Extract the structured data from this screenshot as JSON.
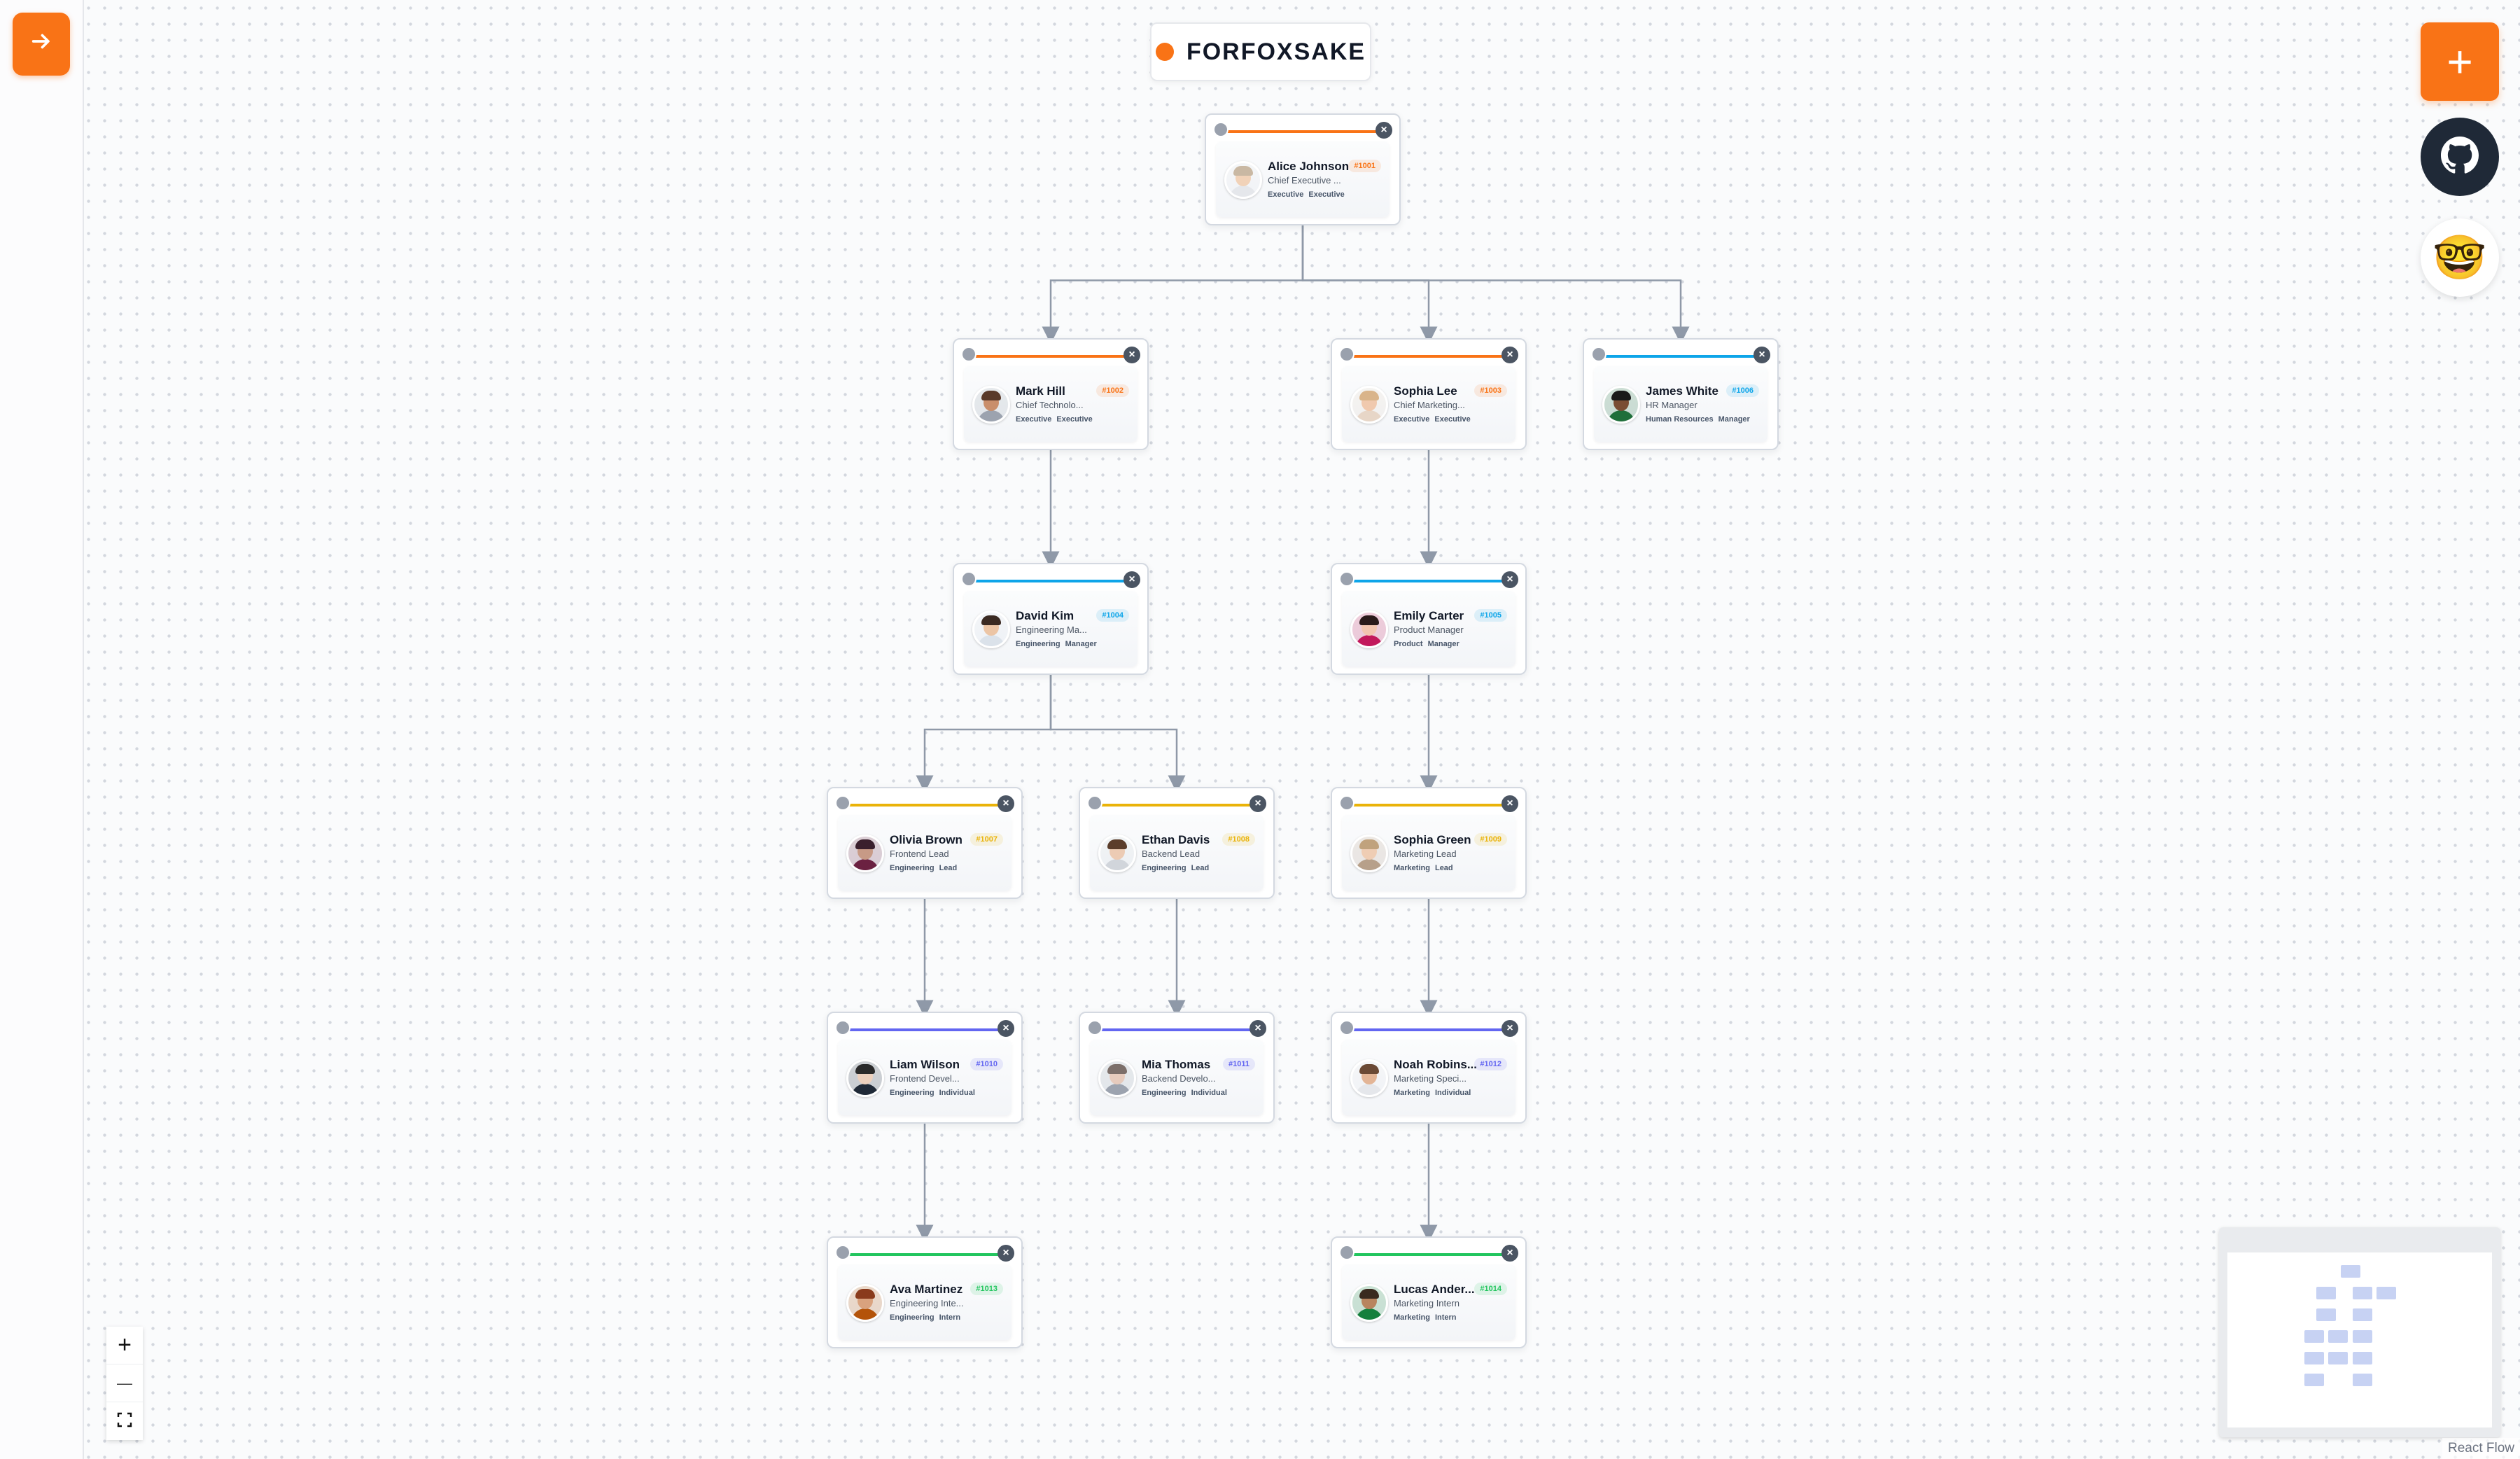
{
  "brand": {
    "name": "FORFOXSAKE",
    "dot_color": "#f97316"
  },
  "sidebar": {
    "toggle_icon": "arrow-right-icon"
  },
  "toolbar": {
    "add_icon": "+",
    "github_icon": "github-icon",
    "emoji": "🤓"
  },
  "zoom_controls": {
    "zoom_in": "+",
    "zoom_out": "—",
    "fit": "fit-view-icon"
  },
  "attribution": "React Flow",
  "nodes": [
    {
      "id": "1001",
      "name": "Alice Johnson",
      "title": "Chief Executive ...",
      "department": "Executive",
      "level": "Executive",
      "badge": "#1001",
      "color": "#f97316",
      "avatar": {
        "skin": "#f1d2b8",
        "hair": "#c9b8a3",
        "shirt": "#e5e7eb"
      }
    },
    {
      "id": "1002",
      "name": "Mark Hill",
      "title": "Chief Technolo...",
      "department": "Executive",
      "level": "Executive",
      "badge": "#1002",
      "color": "#f97316",
      "avatar": {
        "skin": "#c98e6b",
        "hair": "#5a3a2a",
        "shirt": "#9ca3af"
      }
    },
    {
      "id": "1003",
      "name": "Sophia Lee",
      "title": "Chief Marketing...",
      "department": "Executive",
      "level": "Executive",
      "badge": "#1003",
      "color": "#f97316",
      "avatar": {
        "skin": "#f0c9ae",
        "hair": "#d9b48a",
        "shirt": "#e7d6c7"
      }
    },
    {
      "id": "1006",
      "name": "James White",
      "title": "HR Manager",
      "department": "Human Resources",
      "level": "Manager",
      "badge": "#1006",
      "color": "#0ea5e9",
      "avatar": {
        "skin": "#7a4d33",
        "hair": "#1a1a1a",
        "shirt": "#1f6f3a"
      }
    },
    {
      "id": "1004",
      "name": "David Kim",
      "title": "Engineering Ma...",
      "department": "Engineering",
      "level": "Manager",
      "badge": "#1004",
      "color": "#0ea5e9",
      "avatar": {
        "skin": "#ecc5a5",
        "hair": "#3b2a22",
        "shirt": "#dbe2ea"
      }
    },
    {
      "id": "1005",
      "name": "Emily Carter",
      "title": "Product Manager",
      "department": "Product",
      "level": "Manager",
      "badge": "#1005",
      "color": "#0ea5e9",
      "avatar": {
        "skin": "#f2c5b0",
        "hair": "#2a1a1a",
        "shirt": "#c2185b"
      }
    },
    {
      "id": "1007",
      "name": "Olivia Brown",
      "title": "Frontend Lead",
      "department": "Engineering",
      "level": "Lead",
      "badge": "#1007",
      "color": "#eab308",
      "avatar": {
        "skin": "#c79a86",
        "hair": "#3a1f2d",
        "shirt": "#6b2141"
      }
    },
    {
      "id": "1008",
      "name": "Ethan Davis",
      "title": "Backend Lead",
      "department": "Engineering",
      "level": "Lead",
      "badge": "#1008",
      "color": "#eab308",
      "avatar": {
        "skin": "#eccbb4",
        "hair": "#5b3d2b",
        "shirt": "#d1d5db"
      }
    },
    {
      "id": "1009",
      "name": "Sophia Green",
      "title": "Marketing Lead",
      "department": "Marketing",
      "level": "Lead",
      "badge": "#1009",
      "color": "#eab308",
      "avatar": {
        "skin": "#efcdb4",
        "hair": "#c0a27d",
        "shirt": "#b7a08a"
      }
    },
    {
      "id": "1010",
      "name": "Liam Wilson",
      "title": "Frontend Devel...",
      "department": "Engineering",
      "level": "Individual",
      "badge": "#1010",
      "color": "#6366f1",
      "avatar": {
        "skin": "#ecd0bd",
        "hair": "#2a2a2a",
        "shirt": "#1f2937"
      }
    },
    {
      "id": "1011",
      "name": "Mia Thomas",
      "title": "Backend Develo...",
      "department": "Engineering",
      "level": "Individual",
      "badge": "#1011",
      "color": "#6366f1",
      "avatar": {
        "skin": "#e6cbbd",
        "hair": "#7c6f6a",
        "shirt": "#9ca3af"
      }
    },
    {
      "id": "1012",
      "name": "Noah Robins...",
      "title": "Marketing Speci...",
      "department": "Marketing",
      "level": "Individual",
      "badge": "#1012",
      "color": "#6366f1",
      "avatar": {
        "skin": "#e3b596",
        "hair": "#6b4a35",
        "shirt": "#e5e7eb"
      }
    },
    {
      "id": "1013",
      "name": "Ava Martinez",
      "title": "Engineering Inte...",
      "department": "Engineering",
      "level": "Intern",
      "badge": "#1013",
      "color": "#22c55e",
      "avatar": {
        "skin": "#d9a27e",
        "hair": "#8a3b1c",
        "shirt": "#b45309"
      }
    },
    {
      "id": "1014",
      "name": "Lucas Ander...",
      "title": "Marketing Intern",
      "department": "Marketing",
      "level": "Intern",
      "badge": "#1014",
      "color": "#22c55e",
      "avatar": {
        "skin": "#b8845f",
        "hair": "#3a2a1f",
        "shirt": "#15803d"
      }
    }
  ],
  "edges": [
    [
      "1001",
      "1002"
    ],
    [
      "1001",
      "1003"
    ],
    [
      "1001",
      "1006"
    ],
    [
      "1002",
      "1004"
    ],
    [
      "1003",
      "1005"
    ],
    [
      "1004",
      "1007"
    ],
    [
      "1004",
      "1008"
    ],
    [
      "1005",
      "1009"
    ],
    [
      "1007",
      "1010"
    ],
    [
      "1008",
      "1011"
    ],
    [
      "1009",
      "1012"
    ],
    [
      "1010",
      "1013"
    ],
    [
      "1012",
      "1014"
    ]
  ]
}
